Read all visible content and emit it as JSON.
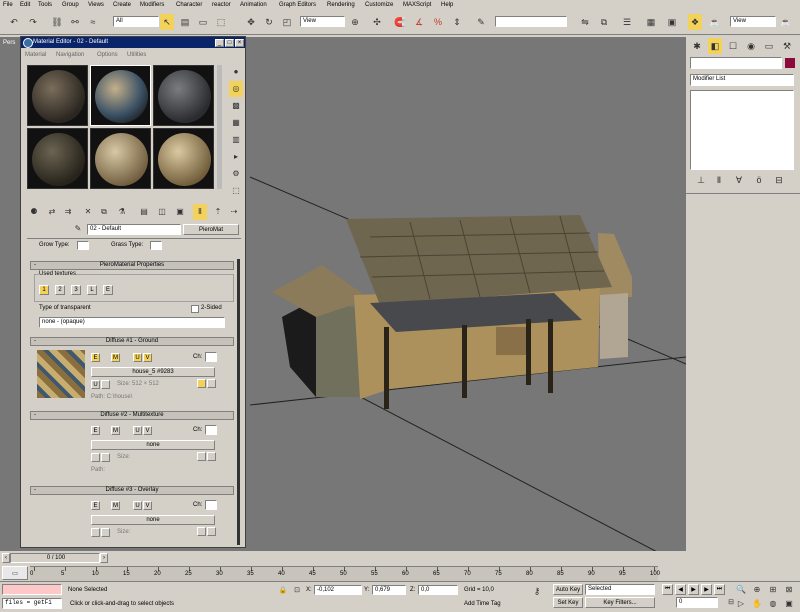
{
  "menu": [
    "File",
    "Edit",
    "Tools",
    "Group",
    "Views",
    "Create",
    "Modifiers",
    "Character",
    "reactor",
    "Animation",
    "Graph Editors",
    "Rendering",
    "Customize",
    "MAXScript",
    "Help"
  ],
  "toolbar": {
    "selection_filter": "All",
    "ref_coord": "View",
    "named_sel": "",
    "view_right": "View"
  },
  "viewport": {
    "label": "Pers"
  },
  "command_panel": {
    "modifier_list": "Modifier List"
  },
  "material_editor": {
    "title": "Material Editor - 02 - Default",
    "menus": [
      "Material",
      "Navigation",
      "Options",
      "Utilities"
    ],
    "material_name": "02 - Default",
    "material_type": "PieroMat",
    "grow_type_label": "Grow Type:",
    "grass_type_label": "Grass Type:",
    "props_rollout": "PieroMaterial Properties",
    "used_textures_label": "Used textures",
    "tex_buttons": [
      "1",
      "2",
      "3",
      "L",
      "E"
    ],
    "transparent_label": "Type of transparent",
    "two_sided_label": "2-Sided",
    "transparent_value": "none - (opaque)",
    "diffuse1": {
      "title": "Diffuse #1 - Ground",
      "buttons": [
        "E",
        "M",
        "U",
        "V"
      ],
      "ch_label": "Ch:",
      "map": "house_5 #9283",
      "uv": "U",
      "size": "Size: 512 × 512",
      "path": "Path: C:\\house\\"
    },
    "diffuse2": {
      "title": "Diffuse #2 - Multitexture",
      "buttons": [
        "E",
        "M",
        "U",
        "V"
      ],
      "ch_label": "Ch:",
      "map": "none",
      "size": "Size:",
      "path": "Path:"
    },
    "diffuse3": {
      "title": "Diffuse #3 - Overlay",
      "buttons": [
        "E",
        "M",
        "U",
        "V"
      ],
      "ch_label": "Ch:",
      "map": "none",
      "size": "Size:"
    }
  },
  "timeline": {
    "frame": "0 / 100",
    "ticks": [
      "0",
      "5",
      "10",
      "15",
      "20",
      "25",
      "30",
      "35",
      "40",
      "45",
      "50",
      "55",
      "60",
      "65",
      "70",
      "75",
      "80",
      "85",
      "90",
      "95",
      "100"
    ]
  },
  "status": {
    "script_field": "files = getFi",
    "selection": "None Selected",
    "prompt": "Click or click-and-drag to select objects",
    "x_label": "X:",
    "x": "-0,102",
    "y_label": "Y:",
    "y": "0,679",
    "z_label": "Z:",
    "z": "0,0",
    "grid": "Grid = 10,0",
    "add_time_tag": "Add Time Tag",
    "auto_key": "Auto Key",
    "set_key": "Set Key",
    "selected": "Selected",
    "key_filters": "Key Filters...",
    "frame_field": "0"
  },
  "colors": {
    "viewport": "#777777",
    "title_bar": "#0a246a",
    "yellow": "#f2d25a",
    "swatch": "#8b0a3a"
  }
}
